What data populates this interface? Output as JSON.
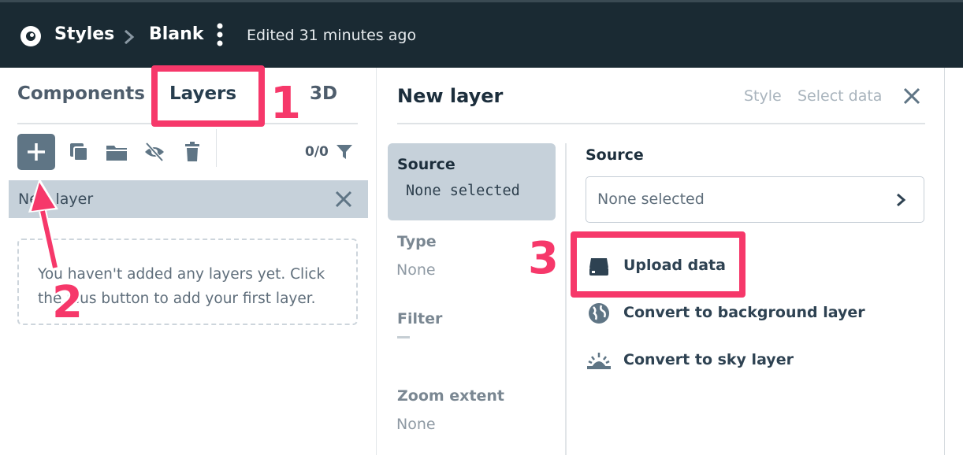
{
  "topbar": {
    "crumb_styles": "Styles",
    "crumb_blank": "Blank",
    "edited": "Edited 31 minutes ago"
  },
  "left": {
    "tabs": {
      "components": "Components",
      "layers": "Layers",
      "three_d": "3D"
    },
    "count": "0/0",
    "new_layer_row": "New layer",
    "empty_text": "You haven't added any layers yet. Click the plus button to add your first layer."
  },
  "right": {
    "title": "New layer",
    "links": {
      "style": "Style",
      "select_data": "Select data"
    },
    "side": {
      "source_label": "Source",
      "source_value": "None selected",
      "type_label": "Type",
      "type_value": "None",
      "filter_label": "Filter",
      "zoom_label": "Zoom extent",
      "zoom_value": "None"
    },
    "source_heading": "Source",
    "source_select_value": "None selected",
    "actions": {
      "upload": "Upload data",
      "background": "Convert to background layer",
      "sky": "Convert to sky layer"
    }
  },
  "annotations": {
    "one": "1",
    "two": "2",
    "three": "3"
  },
  "colors": {
    "topbar": "#1a2a33",
    "highlight": "#f6386a",
    "selected": "#c6d1da",
    "button": "#5f7585"
  },
  "icons": [
    "logo-icon",
    "chevron-right-icon",
    "kebab-icon",
    "plus-icon",
    "duplicate-icon",
    "folder-icon",
    "eye-off-icon",
    "trash-icon",
    "filter-icon",
    "close-icon",
    "upload-icon",
    "globe-icon",
    "sky-icon"
  ]
}
